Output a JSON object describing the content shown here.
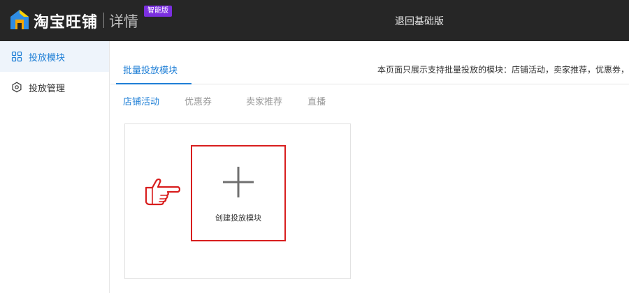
{
  "header": {
    "brand": "淘宝旺铺",
    "section": "详情",
    "badge": "智能版",
    "back_link": "退回基础版"
  },
  "sidebar": {
    "items": [
      {
        "label": "投放模块",
        "icon": "grid-icon",
        "active": true
      },
      {
        "label": "投放管理",
        "icon": "gear-icon",
        "active": false
      }
    ]
  },
  "main": {
    "tab": "批量投放模块",
    "notice": "本页面只展示支持批量投放的模块：店铺活动，卖家推荐，优惠券，",
    "subtabs": [
      {
        "label": "店铺活动",
        "active": true
      },
      {
        "label": "优惠券",
        "active": false
      },
      {
        "label": "卖家推荐",
        "active": false
      },
      {
        "label": "直播",
        "active": false
      }
    ],
    "create_label": "创建投放模块"
  },
  "colors": {
    "topbar": "#262626",
    "accent": "#1f7fd6",
    "badge": "#7b2fe0",
    "highlight": "#d81e1e"
  }
}
